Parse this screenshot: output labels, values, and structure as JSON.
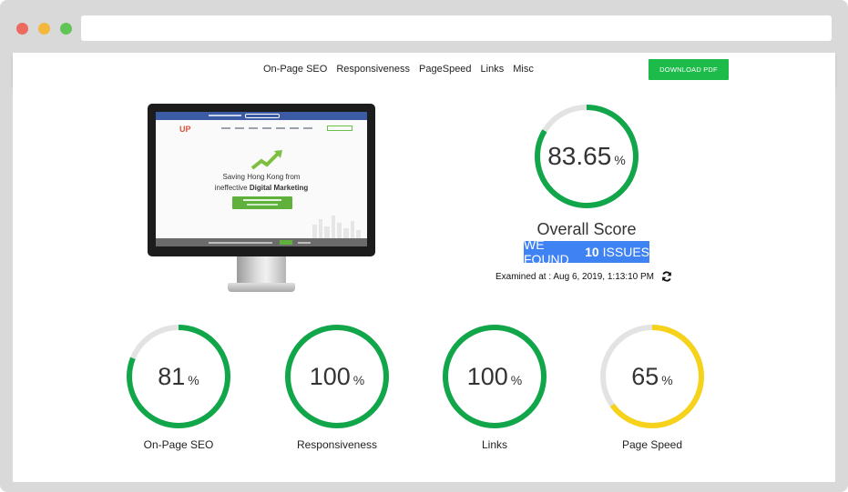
{
  "nav": {
    "links": [
      "On-Page SEO",
      "Responsiveness",
      "PageSpeed",
      "Links",
      "Misc"
    ],
    "download_label": "DOWNLOAD PDF"
  },
  "preview": {
    "headline_line1": "Saving Hong Kong from",
    "headline_line2_prefix": "ineffective",
    "headline_line2_bold": "Digital Marketing",
    "logo_text": "UP"
  },
  "overall": {
    "score": "83.65",
    "pct": "%",
    "fraction": 0.8365,
    "label": "Overall Score",
    "issues_prefix": "WE FOUND",
    "issues_count": "10",
    "issues_suffix": "ISSUES",
    "examined": "Examined at : Aug 6, 2019, 1:13:10 PM"
  },
  "gauges": [
    {
      "value": "81",
      "pct": "%",
      "fraction": 0.81,
      "label": "On-Page SEO",
      "color": "#12a64a"
    },
    {
      "value": "100",
      "pct": "%",
      "fraction": 1.0,
      "label": "Responsiveness",
      "color": "#12a64a"
    },
    {
      "value": "100",
      "pct": "%",
      "fraction": 1.0,
      "label": "Links",
      "color": "#12a64a"
    },
    {
      "value": "65",
      "pct": "%",
      "fraction": 0.65,
      "label": "Page Speed",
      "color": "#f6d31a"
    }
  ],
  "colors": {
    "track": "#e3e3e3",
    "good": "#12a64a",
    "warn": "#f6d31a",
    "accent": "#3f82f4",
    "download": "#1dbb4a"
  }
}
